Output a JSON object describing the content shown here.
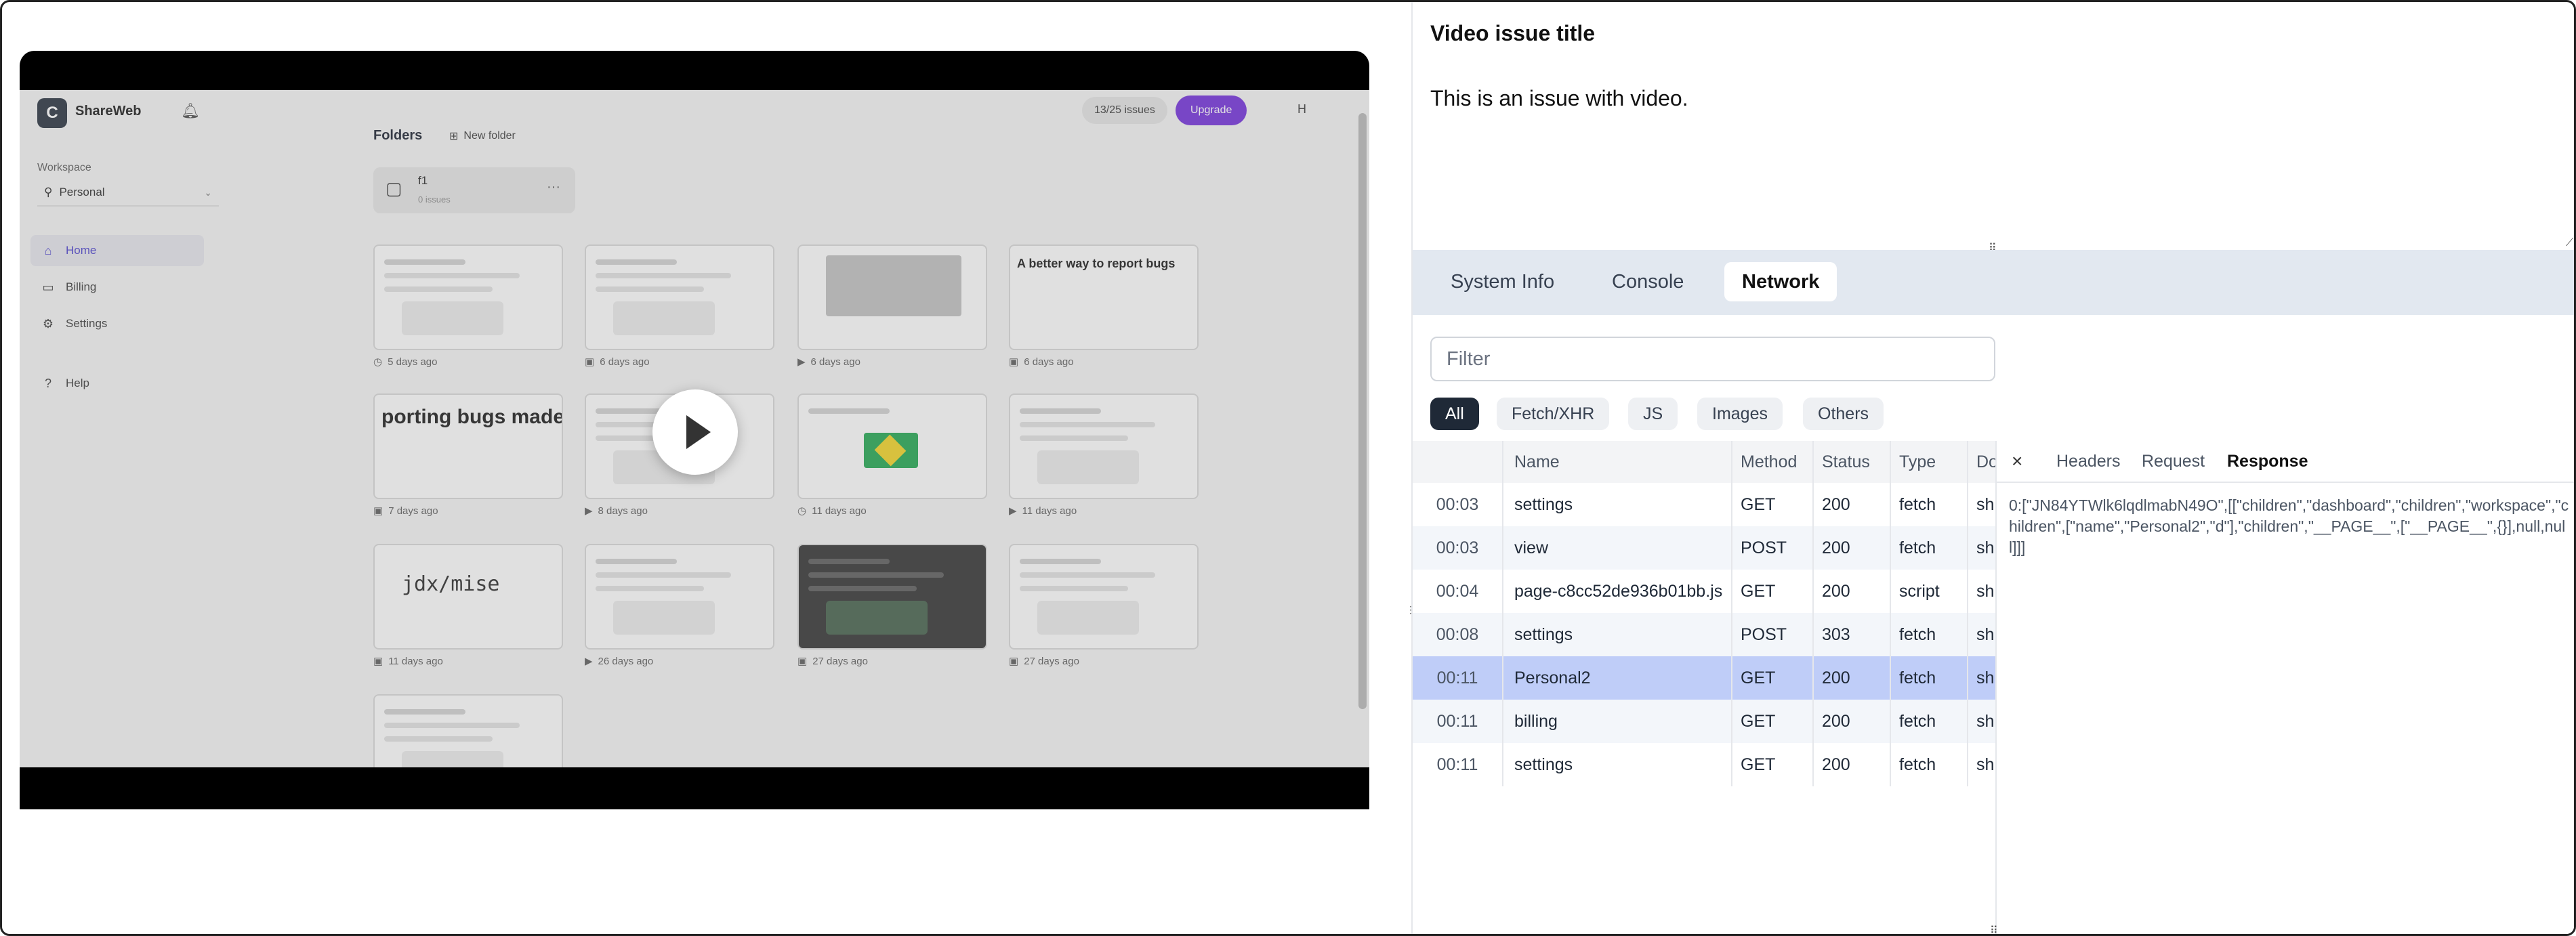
{
  "video": {
    "app": {
      "logo_letter": "C",
      "name": "ShareWeb",
      "workspace_label": "Workspace",
      "workspace_value": "Personal",
      "nav": [
        {
          "label": "Home",
          "icon": "home-icon"
        },
        {
          "label": "Billing",
          "icon": "card-icon"
        },
        {
          "label": "Settings",
          "icon": "gear-icon"
        },
        {
          "label": "Help",
          "icon": "help-icon"
        }
      ],
      "folders_title": "Folders",
      "new_folder_label": "New folder",
      "issues_badge": "13/25 issues",
      "upgrade_label": "Upgrade",
      "avatar_letter": "H",
      "folder": {
        "name": "f1",
        "count": "0 issues"
      },
      "cards": [
        {
          "meta": "5 days ago",
          "icon": "clock-icon",
          "kind": "page"
        },
        {
          "meta": "6 days ago",
          "icon": "image-icon",
          "kind": "page"
        },
        {
          "meta": "6 days ago",
          "icon": "video-icon",
          "kind": "grey"
        },
        {
          "meta": "6 days ago",
          "icon": "image-icon",
          "kind": "text",
          "text": "A better way to report bugs"
        },
        {
          "meta": "7 days ago",
          "icon": "image-icon",
          "kind": "text",
          "text": "porting bugs made simp"
        },
        {
          "meta": "8 days ago",
          "icon": "video-icon",
          "kind": "page"
        },
        {
          "meta": "11 days ago",
          "icon": "clock-icon",
          "kind": "flag"
        },
        {
          "meta": "11 days ago",
          "icon": "video-icon",
          "kind": "page"
        },
        {
          "meta": "11 days ago",
          "icon": "image-icon",
          "kind": "mono",
          "text": "jdx/mise"
        },
        {
          "meta": "26 days ago",
          "icon": "video-icon",
          "kind": "page"
        },
        {
          "meta": "27 days ago",
          "icon": "image-icon",
          "kind": "dark"
        },
        {
          "meta": "27 days ago",
          "icon": "image-icon",
          "kind": "page"
        },
        {
          "meta": "",
          "icon": "",
          "kind": "page"
        }
      ]
    }
  },
  "issue": {
    "title": "Video issue title",
    "description": "This is an issue with video."
  },
  "devtools": {
    "tabs": [
      "System Info",
      "Console",
      "Network"
    ],
    "active_tab": "Network",
    "filter_placeholder": "Filter",
    "chips": [
      "All",
      "Fetch/XHR",
      "JS",
      "Images",
      "Others"
    ],
    "active_chip": "All",
    "columns": {
      "time": "",
      "name": "Name",
      "method": "Method",
      "status": "Status",
      "type": "Type",
      "domain": "Do"
    },
    "rows": [
      {
        "time": "00:03",
        "name": "settings",
        "method": "GET",
        "status": "200",
        "type": "fetch",
        "domain": "sh"
      },
      {
        "time": "00:03",
        "name": "view",
        "method": "POST",
        "status": "200",
        "type": "fetch",
        "domain": "sh"
      },
      {
        "time": "00:04",
        "name": "page-c8cc52de936b01bb.js",
        "method": "GET",
        "status": "200",
        "type": "script",
        "domain": "sh"
      },
      {
        "time": "00:08",
        "name": "settings",
        "method": "POST",
        "status": "303",
        "type": "fetch",
        "domain": "sh"
      },
      {
        "time": "00:11",
        "name": "Personal2",
        "method": "GET",
        "status": "200",
        "type": "fetch",
        "domain": "sh",
        "selected": true
      },
      {
        "time": "00:11",
        "name": "billing",
        "method": "GET",
        "status": "200",
        "type": "fetch",
        "domain": "sh"
      },
      {
        "time": "00:11",
        "name": "settings",
        "method": "GET",
        "status": "200",
        "type": "fetch",
        "domain": "sh"
      }
    ],
    "details": {
      "close_label": "×",
      "tabs": [
        "Headers",
        "Request",
        "Response"
      ],
      "active_tab": "Response",
      "response_text": "0:[\"JN84YTWlk6lqdlmabN49O\",[[\"children\",\"dashboard\",\"children\",\"workspace\",\"children\",[\"name\",\"Personal2\",\"d\"],\"children\",\"__PAGE__\",[\"__PAGE__\",{}],null,null]]]"
    }
  }
}
